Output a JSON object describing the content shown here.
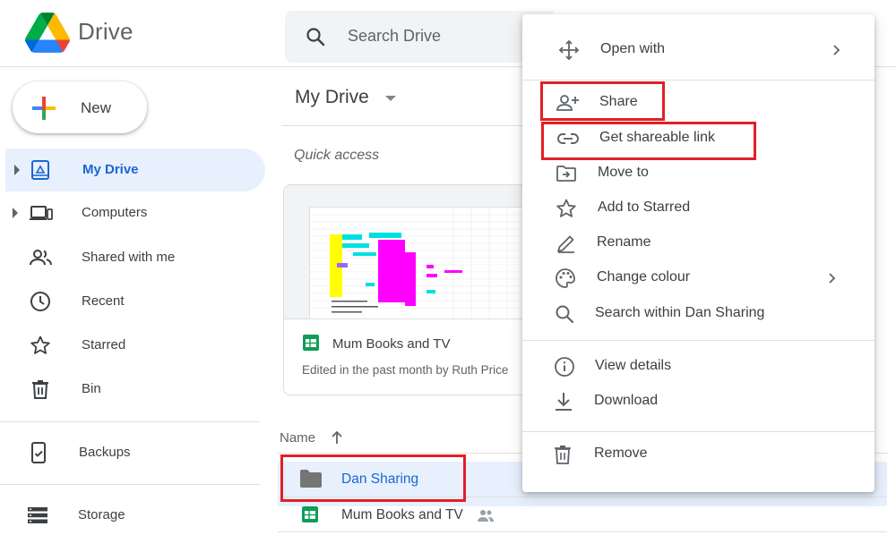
{
  "header": {
    "brand": "Drive",
    "search_placeholder": "Search Drive"
  },
  "sidebar": {
    "new_label": "New",
    "items": [
      {
        "label": "My Drive",
        "icon": "my-drive-icon",
        "active": true
      },
      {
        "label": "Computers",
        "icon": "computers-icon"
      },
      {
        "label": "Shared with me",
        "icon": "shared-with-me-icon"
      },
      {
        "label": "Recent",
        "icon": "clock-icon"
      },
      {
        "label": "Starred",
        "icon": "star-icon"
      },
      {
        "label": "Bin",
        "icon": "trash-icon"
      },
      {
        "label": "Backups",
        "icon": "backups-icon"
      },
      {
        "label": "Storage",
        "icon": "storage-icon"
      }
    ]
  },
  "main": {
    "title": "My Drive",
    "quick_access": "Quick access",
    "card": {
      "name": "Mum Books and TV",
      "subtitle": "Edited in the past month by Ruth Price"
    },
    "list": {
      "column_name": "Name",
      "rows": [
        {
          "name": "Dan Sharing",
          "type": "folder",
          "selected": true
        },
        {
          "name": "Mum Books and TV",
          "type": "sheet",
          "shared": true
        }
      ]
    }
  },
  "context_menu": {
    "items": [
      {
        "label": "Open with",
        "icon": "move-arrows-icon",
        "submenu": true
      },
      {
        "label": "Share",
        "icon": "person-add-icon"
      },
      {
        "label": "Get shareable link",
        "icon": "link-icon"
      },
      {
        "label": "Move to",
        "icon": "move-to-folder-icon"
      },
      {
        "label": "Add to Starred",
        "icon": "star-outline-icon"
      },
      {
        "label": "Rename",
        "icon": "pencil-icon"
      },
      {
        "label": "Change colour",
        "icon": "palette-icon",
        "submenu": true
      },
      {
        "label": "Search within Dan Sharing",
        "icon": "search-icon"
      },
      {
        "label": "View details",
        "icon": "info-icon"
      },
      {
        "label": "Download",
        "icon": "download-icon"
      },
      {
        "label": "Remove",
        "icon": "trash-icon"
      }
    ]
  },
  "colors": {
    "accent_blue": "#1967d2",
    "active_bg": "#e8f0fe",
    "highlight_red": "#e21f26"
  }
}
